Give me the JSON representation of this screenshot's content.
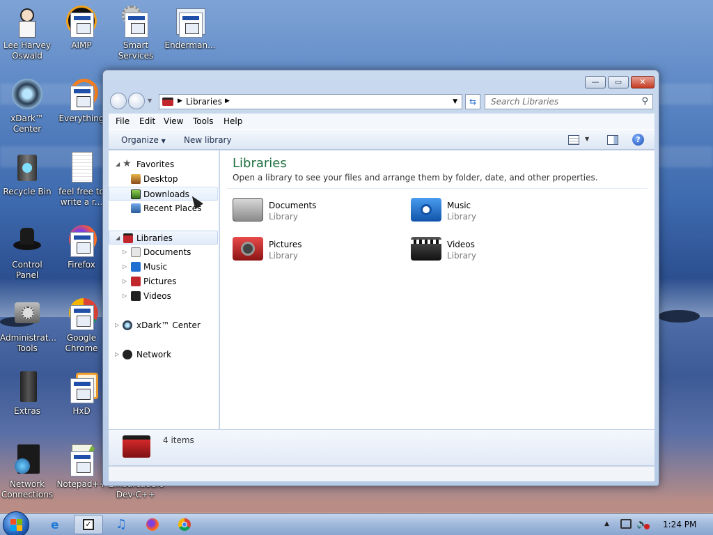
{
  "desktop": {
    "icons": [
      {
        "label": "Lee Harvey\nOswald"
      },
      {
        "label": "AIMP"
      },
      {
        "label": "Smart\nServices"
      },
      {
        "label": "Enderman..."
      },
      {
        "label": "xDark™\nCenter"
      },
      {
        "label": "Everything"
      },
      {
        "label": "Recycle Bin"
      },
      {
        "label": "feel free to\nwrite a r..."
      },
      {
        "label": "Control Panel"
      },
      {
        "label": "Firefox"
      },
      {
        "label": "Administrat...\nTools"
      },
      {
        "label": "Google\nChrome"
      },
      {
        "label": "Extras"
      },
      {
        "label": "HxD"
      },
      {
        "label": "Network\nConnections"
      },
      {
        "label": "Notepad++"
      },
      {
        "label": "Embarcadero\nDev-C++"
      }
    ]
  },
  "window": {
    "buttons": {
      "minimize": "—",
      "maximize": "▭",
      "close": "✕"
    },
    "address": {
      "text": "Libraries"
    },
    "search": {
      "placeholder": "Search Libraries"
    },
    "menu": [
      "File",
      "Edit",
      "View",
      "Tools",
      "Help"
    ],
    "toolbar": {
      "organize": "Organize",
      "new_library": "New library"
    },
    "nav": {
      "favorites": "Favorites",
      "desktop": "Desktop",
      "downloads": "Downloads",
      "recent": "Recent Places",
      "libraries": "Libraries",
      "documents": "Documents",
      "music": "Music",
      "pictures": "Pictures",
      "videos": "Videos",
      "xdark": "xDark™ Center",
      "network": "Network"
    },
    "content": {
      "title": "Libraries",
      "subtitle": "Open a library to see your files and arrange them by folder, date, and other properties.",
      "items": [
        {
          "name": "Documents",
          "type": "Library"
        },
        {
          "name": "Music",
          "type": "Library"
        },
        {
          "name": "Pictures",
          "type": "Library"
        },
        {
          "name": "Videos",
          "type": "Library"
        }
      ]
    },
    "details": {
      "count": "4 items"
    }
  },
  "taskbar": {
    "clock": "1:24 PM"
  }
}
